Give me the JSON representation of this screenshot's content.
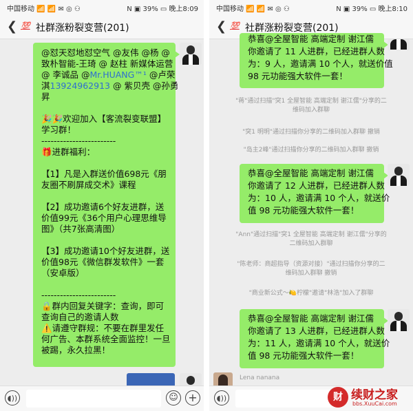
{
  "left": {
    "status": {
      "carrier": "中国移动 📶 📶 ✉ ◎ ⚇",
      "right": "N ▣ 39% ▭ 晚上8:09"
    },
    "title": {
      "badge": "💯",
      "text": "社群涨粉裂变营(201)"
    },
    "bubble_lines": [
      "@怼天怼地怼空气 @友伟 @杨 @",
      "致朴智能-王琦 @ 赵柱 新媒体运营",
      "@ 李诚品 @Mr.HUANG™¹ @卢荣",
      "淇13924962913 @ 紫贝壳 @孙勇",
      "昇",
      "",
      "🎉🎉欢迎加入【客流裂变联盟】",
      "学习群！",
      "------------------------",
      "🎁进群福利：",
      "",
      "【1】凡是入群送价值698元《朋",
      "友圈不刷屏成交术》课程",
      "",
      "【2】成功邀请6个好友进群，送",
      "价值99元《36个用户心理思维导",
      "图》（共7张高清图）",
      "",
      "【3】成功邀请10个好友进群，送",
      "价值98元《微信群发软件》一套",
      "（安卓版）",
      "",
      "------------------------",
      "🔒群内回复关键字：查询，即可",
      "查询自己的邀请人数",
      "⚠️请遵守群规：不要在群里发任",
      "何广告、本群系统全面监控！一旦",
      "被踢，永久拉黑！"
    ]
  },
  "right": {
    "status": {
      "carrier": "中国移动 📶 📶 ✉ ◎ ⚇",
      "right": "N ▣ 39% ▭ 晚上8:10"
    },
    "title": {
      "badge": "💯",
      "text": "社群涨粉裂变营(201)"
    },
    "bubble1": [
      "恭喜@全屋智能 高端定制 谢江儒",
      "你邀请了 11 人进群，已经进群人数",
      "为：9 人，邀请满 10 个人，就送价值",
      "98 元功能强大软件一套！"
    ],
    "sys1": [
      "\"蒋\"通过扫描\"突1 全屋智能 高端定制 谢江儒\"分享的二",
      "维码加入群聊"
    ],
    "sys2": [
      "\"突1 明明\"通过扫描你分享的二维码加入群聊  撤销"
    ],
    "sys3": [
      "\"岛主2峰\"通过扫描你分享的二维码加入群聊  撤销"
    ],
    "bubble2": [
      "恭喜@全屋智能 高端定制 谢江儒",
      "你邀请了 12 人进群，已经进群人数",
      "为：10 人，邀请满 10 个人，就送价",
      "值 98 元功能强大软件一套！"
    ],
    "sys4": [
      "\"Ann\"通过扫描\"突1 全屋智能 高端定制 谢江儒\"分享的",
      "二维码加入群聊"
    ],
    "sys5": [
      "\"陈老师：商超指导（资源对接）\"通过扫描你分享的二",
      "维码加入群聊  撤销"
    ],
    "sys6": [
      "\"商业新公式～🍋柠檬\"邀请\"林浩\"加入了群聊"
    ],
    "bubble3": [
      "恭喜@全屋智能 高端定制 谢江儒",
      "你邀请了 13 人进群，已经进群人数",
      "为：11 人，邀请满 10 个人，就送价",
      "值 98 元功能强大软件一套！"
    ],
    "sender": "Lena nanana"
  },
  "watermark": {
    "title": "续财之家",
    "url": "bbs.XuuCai.com"
  }
}
